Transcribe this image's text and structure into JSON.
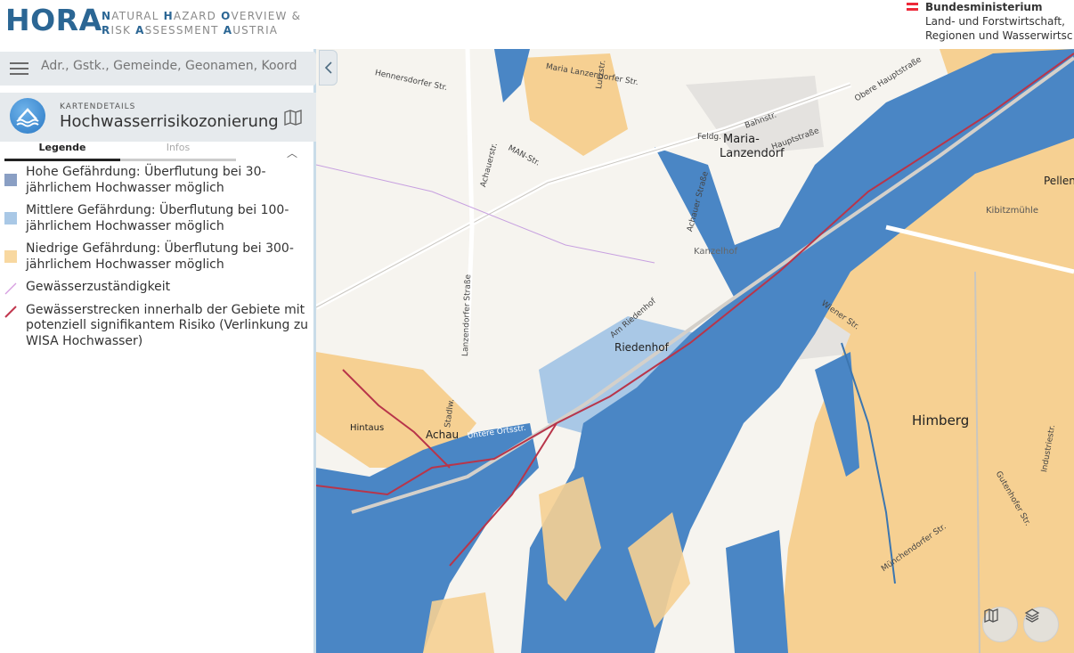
{
  "header": {
    "logo": "HORA",
    "subtitle_line1": [
      "N",
      "ATURAL ",
      "H",
      "AZARD ",
      "O",
      "VERVIEW &"
    ],
    "subtitle_line2": [
      "R",
      "ISK ",
      "A",
      "SSESSMENT ",
      "A",
      "USTRIA"
    ],
    "ministry": {
      "name": "Bundesministerium",
      "line1": "Land- und Forstwirtschaft,",
      "line2": "Regionen und Wasserwirtsc"
    },
    "colors": {
      "brand": "#2b6694",
      "flag_red": "#ed2939"
    }
  },
  "search": {
    "placeholder": "Adr., Gstk., Gemeinde, Geonamen, Koord"
  },
  "card": {
    "kicker": "KARTENDETAILS",
    "title": "Hochwasserrisikozonierung",
    "icon": "flood-icon"
  },
  "tabs": [
    {
      "label": "Legende",
      "active": true
    },
    {
      "label": "Infos",
      "active": false
    }
  ],
  "legend": [
    {
      "label": "Hohe Gefährdung: Überflutung bei 30-jährlichem Hochwasser möglich",
      "color": "#8a9fc4",
      "kind": "swatch"
    },
    {
      "label": "Mittlere Gefährdung: Überflutung bei 100-jährlichem Hochwasser möglich",
      "color": "#a9c8e6",
      "kind": "swatch"
    },
    {
      "label": "Niedrige Gefährdung: Überflutung bei 300-jährlichem Hochwasser möglich",
      "color": "#f8d8a0",
      "kind": "swatch"
    },
    {
      "label": "Gewässerzuständigkeit",
      "color": "#d69ee0",
      "kind": "line"
    },
    {
      "label": "Gewässerstrecken innerhalb der Gebiete mit potenziell signifikantem Risiko (Verlinkung zu WISA Hochwasser)",
      "color": "#c1374e",
      "kind": "line"
    }
  ],
  "map": {
    "colors": {
      "high": "#4a86c5",
      "medium": "#a9c8e6",
      "low": "#f6d092",
      "river_red": "#b8354a",
      "background": "#f6f4ef"
    },
    "places": {
      "maria": "Maria-",
      "lanzendorf": "Lanzendorf",
      "himberg": "Himberg",
      "riedenhof": "Riedenhof",
      "achau": "Achau",
      "kanzelhof": "Kanzelhof",
      "kibitzmuehle": "Kibitzmühle",
      "pellen": "Pellen",
      "hintaus": "Hintaus"
    },
    "streets": {
      "hennersdorfer": "Hennersdorfer Str.",
      "maria_lanzendorfer": "Maria Lanzendorfer Str.",
      "lutzstr": "Lutzstr.",
      "obere_haupt": "Obere Hauptstraße",
      "bahnstr": "Bahnstr.",
      "hauptstrasse": "Hauptstraße",
      "feldg": "Feldg.",
      "achauerstr": "Achauerstr.",
      "man_str": "MAN-Str.",
      "lanzendorfer": "Lanzendorfer Straße",
      "am_riedenhof": "Am Riedenhof",
      "achauer_str": "Achauer Straße",
      "untere_orts": "Untere Ortsstr.",
      "stadlw": "Stadlw.",
      "wiener_str": "Wiener Str.",
      "industriestr": "Industriestr.",
      "gutenhofer": "Gutenhofer Str.",
      "muenchendorfer": "Münchendorfer Str."
    },
    "buttons": [
      "basemap-button",
      "layers-button"
    ]
  }
}
